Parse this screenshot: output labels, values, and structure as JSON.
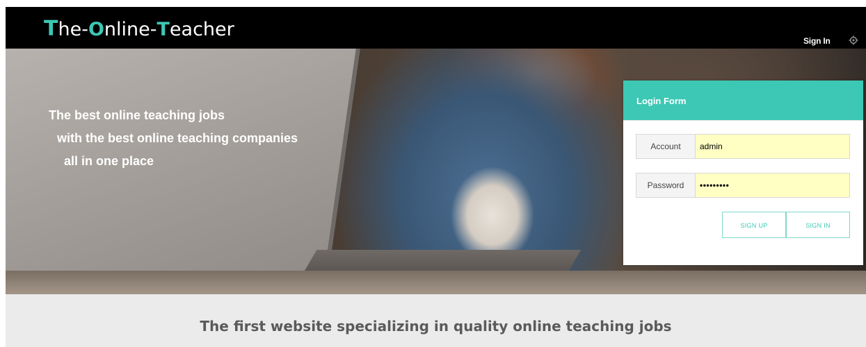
{
  "navbar": {
    "logo": {
      "part1_initial": "T",
      "part1_rest": "he-",
      "part2_initial": "O",
      "part2_rest": "nline-",
      "part3_initial": "T",
      "part3_rest": "eacher"
    },
    "signin_label": "Sign In",
    "settings_icon": "gear-icon"
  },
  "hero": {
    "lines": [
      "The best online teaching jobs",
      "with the best online teaching companies",
      "all in one place"
    ]
  },
  "login": {
    "title": "Login Form",
    "account_label": "Account",
    "account_value": "admin",
    "password_label": "Password",
    "password_value": "•••••••••",
    "signup_label": "SIGN UP",
    "signin_label": "SIGN IN"
  },
  "tagline": "The first website specializing in quality online teaching jobs",
  "colors": {
    "accent": "#3cc8b4",
    "navbar_bg": "#000000",
    "input_bg": "#ffffc4",
    "band_bg": "#ebebeb"
  }
}
